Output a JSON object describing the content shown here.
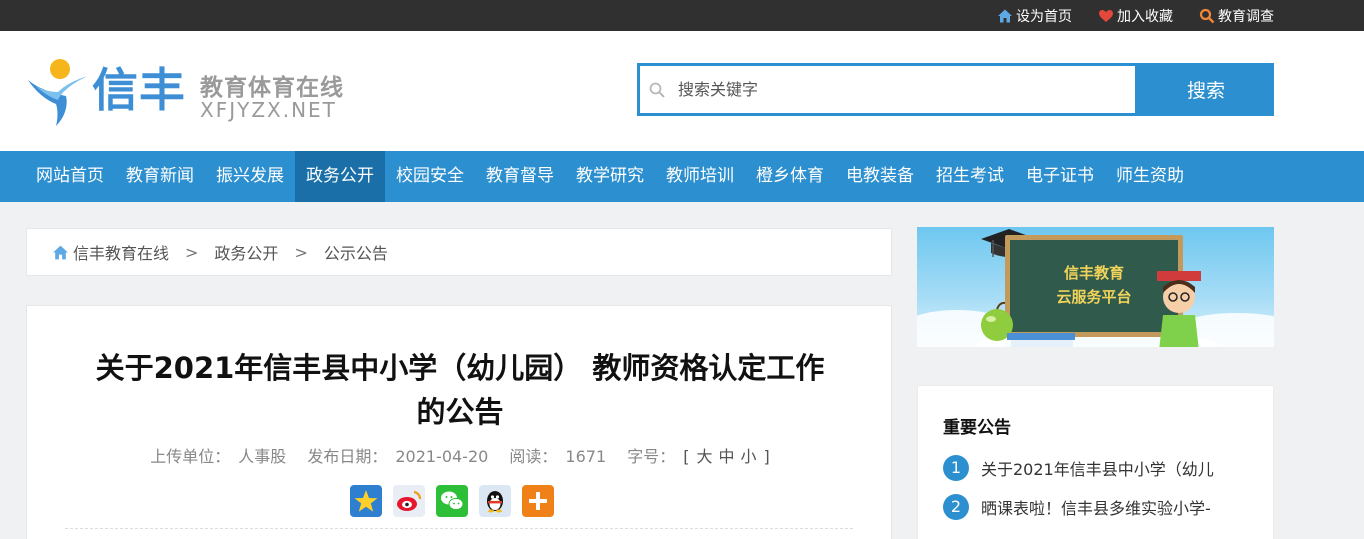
{
  "topbar": {
    "links": [
      {
        "label": "设为首页",
        "icon": "home-icon"
      },
      {
        "label": "加入收藏",
        "icon": "heart-icon"
      },
      {
        "label": "教育调查",
        "icon": "search-icon"
      }
    ]
  },
  "header": {
    "logo_name": "信丰",
    "logo_sub": "教育体育在线",
    "logo_domain": "XFJYZX.NET",
    "search_placeholder": "搜索关键字",
    "search_button": "搜索"
  },
  "nav": {
    "items": [
      "网站首页",
      "教育新闻",
      "振兴发展",
      "政务公开",
      "校园安全",
      "教育督导",
      "教学研究",
      "教师培训",
      "橙乡体育",
      "电教装备",
      "招生考试",
      "电子证书",
      "师生资助"
    ],
    "active_index": 3
  },
  "breadcrumb": {
    "items": [
      "信丰教育在线",
      "政务公开",
      "公示公告"
    ],
    "separator": ">"
  },
  "article": {
    "title_line1": "关于2021年信丰县中小学（幼儿园） 教师资格认定工作",
    "title_line2": "的公告",
    "meta": {
      "unit_label": "上传单位：",
      "unit_value": "人事股",
      "date_label": "发布日期：",
      "date_value": "2021-04-20",
      "reads_label": "阅读：",
      "reads_value": "1671",
      "fontsize_label": "字号：",
      "fontsize_open": "[",
      "fontsize_large": "大",
      "fontsize_medium": "中",
      "fontsize_small": "小",
      "fontsize_close": "]"
    }
  },
  "banner": {
    "line1": "信丰教育",
    "line2": "云服务平台"
  },
  "sidebar": {
    "notices_title": "重要公告",
    "notices": [
      {
        "num": "1",
        "text": "关于2021年信丰县中小学（幼儿"
      },
      {
        "num": "2",
        "text": "晒课表啦！信丰县多维实验小学-"
      }
    ]
  },
  "colors": {
    "primary": "#2c8fcf",
    "nav_active": "#1b6fa8",
    "topbar": "#303030"
  }
}
